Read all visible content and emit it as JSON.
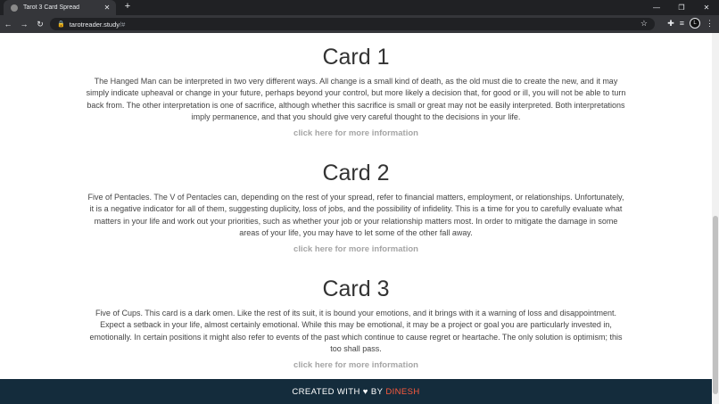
{
  "browser": {
    "tab_title": "Tarot 3 Card Spread",
    "url_host": "tarotreader.study",
    "url_path": "/#",
    "avatar_letter": "L"
  },
  "cards": [
    {
      "title": "Card 1",
      "text": "The Hanged Man can be interpreted in two very different ways. All change is a small kind of death, as the old must die to create the new, and it may simply indicate upheaval or change in your future, perhaps beyond your control, but more likely a decision that, for good or ill, you will not be able to turn back from. The other interpretation is one of sacrifice, although whether this sacrifice is small or great may not be easily interpreted. Both interpretations imply permanence, and that you should give very careful thought to the decisions in your life.",
      "link": "click here for more information"
    },
    {
      "title": "Card 2",
      "text": "Five of Pentacles. The V of Pentacles can, depending on the rest of your spread, refer to financial matters, employment, or relationships. Unfortunately, it is a negative indicator for all of them, suggesting duplicity, loss of jobs, and the possibility of infidelity. This is a time for you to carefully evaluate what matters in your life and work out your priorities, such as whether your job or your relationship matters most. In order to mitigate the damage in some areas of your life, you may have to let some of the other fall away.",
      "link": "click here for more information"
    },
    {
      "title": "Card 3",
      "text": "Five of Cups. This card is a dark omen. Like the rest of its suit, it is bound your emotions, and it brings with it a warning of loss and disappointment. Expect a setback in your life, almost certainly emotional. While this may be emotional, it may be a project or goal you are particularly invested in, emotionally. In certain positions it might also refer to events of the past which continue to cause regret or heartache. The only solution is optimism; this too shall pass.",
      "link": "click here for more information"
    }
  ],
  "footer": {
    "prefix": "CREATED WITH",
    "heart": "♥",
    "by": "BY",
    "author": "DINESH"
  }
}
